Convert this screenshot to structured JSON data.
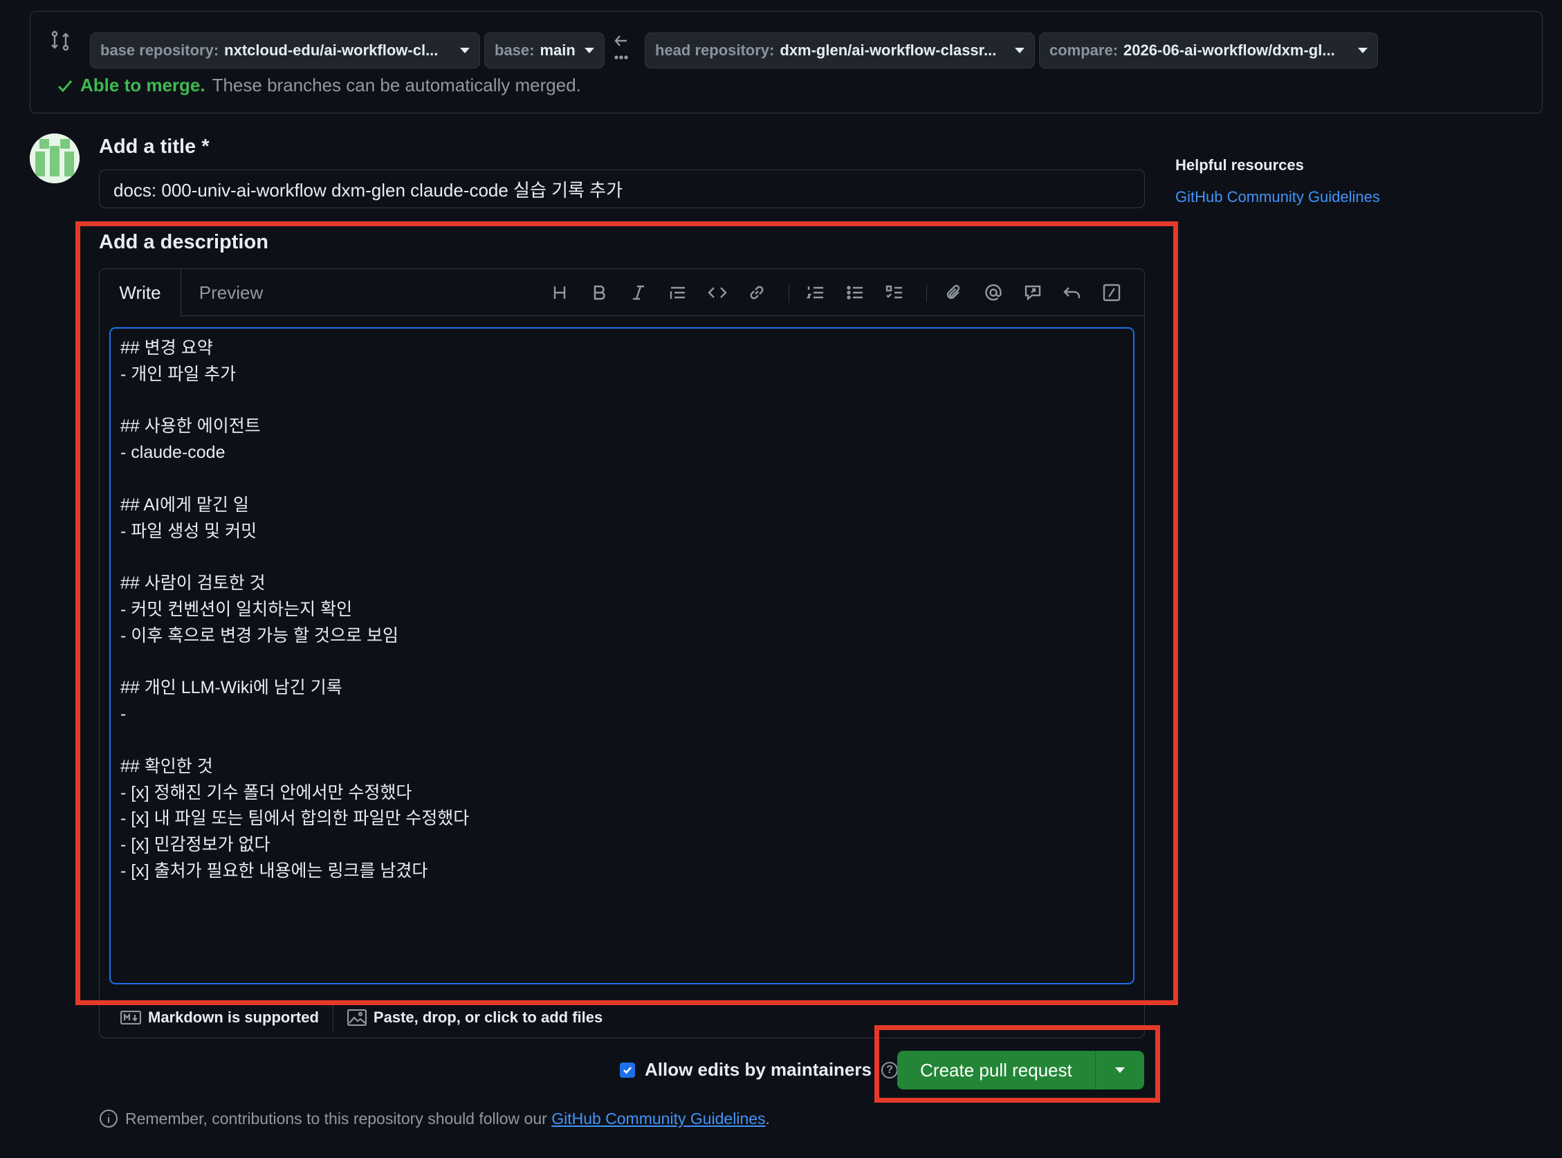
{
  "compare_bar": {
    "base_repository": {
      "key": "base repository:",
      "value": "nxtcloud-edu/ai-workflow-cl..."
    },
    "base": {
      "key": "base:",
      "value": "main"
    },
    "head_repository": {
      "key": "head repository:",
      "value": "dxm-glen/ai-workflow-classr..."
    },
    "compare": {
      "key": "compare:",
      "value": "2026-06-ai-workflow/dxm-gl..."
    },
    "merge_status": {
      "label": "Able to merge.",
      "message": "These branches can be automatically merged."
    }
  },
  "title_section": {
    "heading": "Add a title *",
    "value": "docs: 000-univ-ai-workflow dxm-glen claude-code 실습 기록 추가"
  },
  "description_section": {
    "heading": "Add a description",
    "tabs": [
      "Write",
      "Preview"
    ],
    "toolbar_icons": [
      "heading-icon",
      "bold-icon",
      "italic-icon",
      "quote-icon",
      "code-icon",
      "link-icon",
      "ordered-list-icon",
      "unordered-list-icon",
      "task-list-icon",
      "attach-icon",
      "mention-icon",
      "reference-icon",
      "undo-icon",
      "slash-command-icon"
    ],
    "body": "## 변경 요약\n- 개인 파일 추가\n\n## 사용한 에이전트\n- claude-code\n\n## AI에게 맡긴 일\n- 파일 생성 및 커밋\n\n## 사람이 검토한 것\n- 커밋 컨벤션이 일치하는지 확인\n- 이후 혹으로 변경 가능 할 것으로 보임\n\n## 개인 LLM-Wiki에 남긴 기록\n-\n\n## 확인한 것\n- [x] 정해진 기수 폴더 안에서만 수정했다\n- [x] 내 파일 또는 팀에서 합의한 파일만 수정했다\n- [x] 민감정보가 없다\n- [x] 출처가 필요한 내용에는 링크를 남겼다",
    "footer_markdown": "Markdown is supported",
    "footer_files": "Paste, drop, or click to add files"
  },
  "sidebar": {
    "title": "Helpful resources",
    "link": "GitHub Community Guidelines"
  },
  "actions": {
    "allow_edits_label": "Allow edits by maintainers",
    "allow_edits_checked": true,
    "create_button": "Create pull request"
  },
  "footer_note": {
    "prefix": "Remember, contributions to this repository should follow our",
    "link": "GitHub Community Guidelines",
    "suffix": "."
  },
  "colors": {
    "background": "#0d1117",
    "accent_green": "#238636",
    "link_blue": "#4493f8",
    "highlight_red": "#e53a2a"
  }
}
